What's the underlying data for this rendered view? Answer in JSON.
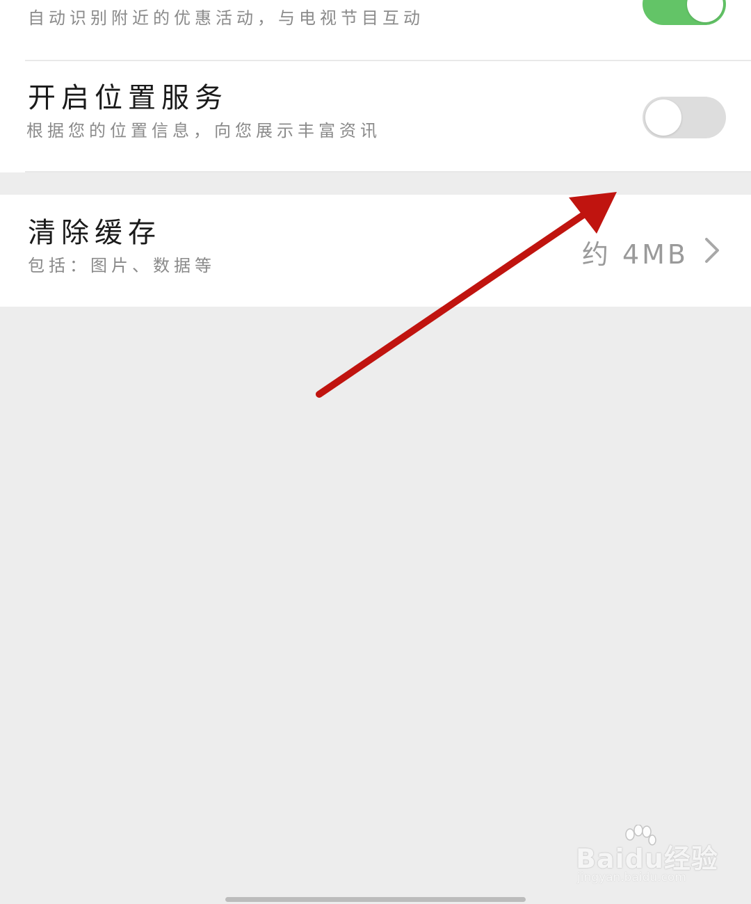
{
  "settings": {
    "nearby": {
      "subtitle": "自动识别附近的优惠活动，与电视节目互动",
      "toggle_state": "on"
    },
    "location": {
      "title": "开启位置服务",
      "subtitle": "根据您的位置信息，向您展示丰富资讯",
      "toggle_state": "off"
    },
    "cache": {
      "title": "清除缓存",
      "subtitle": "包括：图片、数据等",
      "size": "约 4MB"
    }
  },
  "watermark": {
    "brand": "Baidu经验",
    "url": "jingyan.baidu.com"
  },
  "icons": {
    "chevron": "chevron-right-icon",
    "annotation": "red-arrow-annotation"
  },
  "colors": {
    "toggle_on": "#63c467",
    "toggle_off": "#dddddd",
    "annotation_arrow": "#c0140f",
    "background": "#ededed"
  }
}
